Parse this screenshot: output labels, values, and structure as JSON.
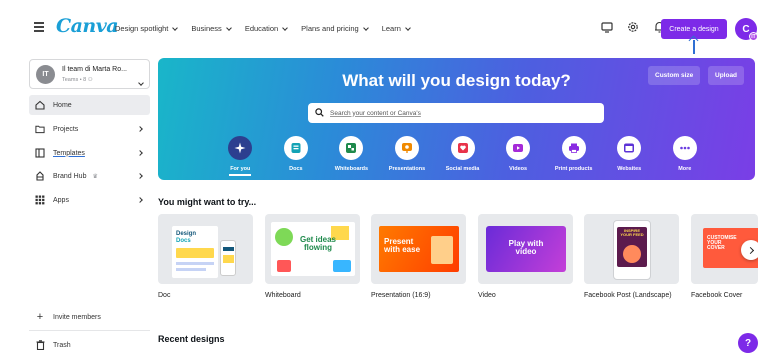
{
  "header": {
    "logo": "Canva",
    "nav": [
      {
        "label": "Design spotlight"
      },
      {
        "label": "Business"
      },
      {
        "label": "Education"
      },
      {
        "label": "Plans and pricing"
      },
      {
        "label": "Learn"
      }
    ],
    "create_label": "Create a design",
    "avatar_initial": "C",
    "avatar_sub": "IT"
  },
  "sidebar": {
    "team_badge": "IT",
    "team_name": "Il team di Marta Ro...",
    "team_sub": "Teams • 8",
    "items": [
      {
        "label": "Home"
      },
      {
        "label": "Projects"
      },
      {
        "label": "Templates"
      },
      {
        "label": "Brand Hub"
      },
      {
        "label": "Apps"
      }
    ],
    "invite_label": "Invite members",
    "trash_label": "Trash"
  },
  "hero": {
    "title": "What will you design today?",
    "custom_size": "Custom size",
    "upload": "Upload",
    "search_placeholder": "Search your content or Canva's",
    "categories": [
      {
        "label": "For you",
        "icon": "sparkle-icon",
        "color": "#1e2a78"
      },
      {
        "label": "Docs",
        "icon": "doc-icon",
        "color": "#13a3b5"
      },
      {
        "label": "Whiteboards",
        "icon": "whiteboard-icon",
        "color": "#1f8a4c"
      },
      {
        "label": "Presentations",
        "icon": "presentation-icon",
        "color": "#f08a00"
      },
      {
        "label": "Social media",
        "icon": "heart-icon",
        "color": "#e8334a"
      },
      {
        "label": "Videos",
        "icon": "video-icon",
        "color": "#a52ad8"
      },
      {
        "label": "Print products",
        "icon": "printer-icon",
        "color": "#8a2be2"
      },
      {
        "label": "Websites",
        "icon": "monitor-icon",
        "color": "#5b32d6"
      },
      {
        "label": "More",
        "icon": "more-icon",
        "color": "#6a3ce0"
      }
    ]
  },
  "try_section": {
    "title": "You might want to try...",
    "cards": [
      {
        "label": "Doc",
        "thumb_title": "Design",
        "thumb_sub": "Docs"
      },
      {
        "label": "Whiteboard",
        "thumb_title": "Get ideas flowing"
      },
      {
        "label": "Presentation (16:9)",
        "thumb_title": "Present with ease"
      },
      {
        "label": "Video",
        "thumb_title": "Play with video"
      },
      {
        "label": "Facebook Post (Landscape)",
        "thumb_title": "INSPIRE YOUR FEED"
      },
      {
        "label": "Facebook Cover",
        "thumb_title": "CUSTOMISE YOUR COVER"
      }
    ]
  },
  "recent_section": {
    "title": "Recent designs"
  },
  "help_label": "?",
  "colors": {
    "brand_purple": "#7d2ae8",
    "logo_blue": "#1a9fd6"
  }
}
